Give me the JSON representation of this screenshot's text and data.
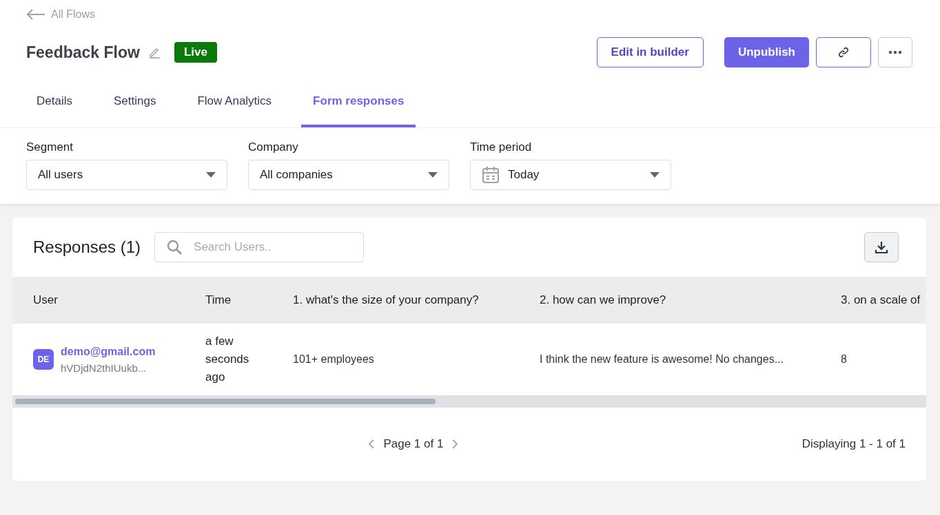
{
  "back_link": "All Flows",
  "title": "Feedback Flow",
  "status_badge": "Live",
  "actions": {
    "edit": "Edit in builder",
    "unpublish": "Unpublish"
  },
  "tabs": [
    {
      "label": "Details",
      "selected": false
    },
    {
      "label": "Settings",
      "selected": false
    },
    {
      "label": "Flow Analytics",
      "selected": false
    },
    {
      "label": "Form responses",
      "selected": true
    }
  ],
  "filters": [
    {
      "label": "Segment",
      "value": "All users",
      "kind": "plain"
    },
    {
      "label": "Company",
      "value": "All companies",
      "kind": "plain"
    },
    {
      "label": "Time period",
      "value": "Today",
      "kind": "date"
    }
  ],
  "responses": {
    "title": "Responses (1)",
    "search": {
      "placeholder": "Search Users.."
    },
    "columns": [
      "User",
      "Time",
      "1. what's the size of your company?",
      "2. how can we improve?",
      "3. on a scale of"
    ],
    "rows": [
      {
        "avatar": "DE",
        "email": "demo@gmail.com",
        "user_id": "hVDjdN2thIUukb...",
        "time": "a few seconds ago",
        "answers": [
          "101+ employees",
          "I think the new feature is awesome! No changes...",
          "8"
        ]
      }
    ],
    "pagination": "Page 1 of 1",
    "display_count": "Displaying 1 - 1 of 1"
  }
}
